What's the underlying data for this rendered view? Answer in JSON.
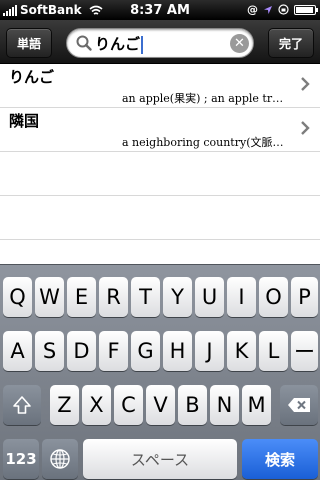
{
  "status_bar": {
    "carrier": "SoftBank",
    "time": "8:37 AM",
    "signal_bars": 5,
    "battery_level": 0.95,
    "icons": [
      "wifi-icon",
      "at-sign-icon",
      "location-arrow-icon",
      "lock-rotation-icon",
      "battery-icon"
    ]
  },
  "toolbar": {
    "left_button": "単語",
    "right_button": "完了",
    "search_value": "りんご",
    "search_icon": "magnifier-icon",
    "clear_icon": "clear-x-icon"
  },
  "results": [
    {
      "word": "りんご",
      "definition": "an apple(果実) ; an apple tr…"
    },
    {
      "word": "隣国",
      "definition": "a neighboring country(文脈…"
    }
  ],
  "keyboard": {
    "row1": [
      "Q",
      "W",
      "E",
      "R",
      "T",
      "Y",
      "U",
      "I",
      "O",
      "P"
    ],
    "row2": [
      "A",
      "S",
      "D",
      "F",
      "G",
      "H",
      "J",
      "K",
      "L",
      "ー"
    ],
    "row3": [
      "Z",
      "X",
      "C",
      "V",
      "B",
      "N",
      "M"
    ],
    "shift_icon": "shift-arrow-icon",
    "delete_icon": "backspace-icon",
    "numbers_label": "123",
    "globe_icon": "globe-icon",
    "space_label": "スペース",
    "search_label": "検索"
  },
  "colors": {
    "accent_blue": "#1a5fd6",
    "cursor": "#3b6ecf"
  }
}
